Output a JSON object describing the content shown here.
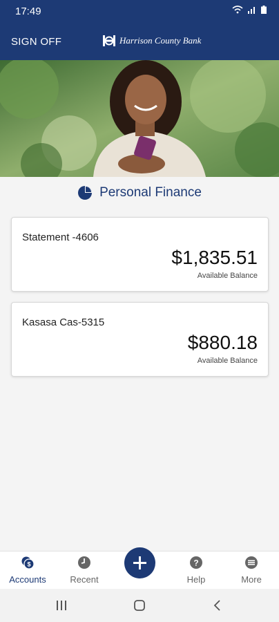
{
  "status_bar": {
    "time": "17:49"
  },
  "header": {
    "sign_off_label": "SIGN OFF",
    "bank_name": "Harrison County Bank"
  },
  "section": {
    "title": "Personal Finance"
  },
  "accounts": [
    {
      "name": "Statement -4606",
      "balance": "$1,835.51",
      "balance_label": "Available Balance"
    },
    {
      "name": "Kasasa Cas-5315",
      "balance": "$880.18",
      "balance_label": "Available Balance"
    }
  ],
  "bottom_nav": {
    "items": [
      {
        "label": "Accounts",
        "icon": "accounts-icon"
      },
      {
        "label": "Recent",
        "icon": "clock-icon"
      },
      {
        "label": "Help",
        "icon": "help-icon"
      },
      {
        "label": "More",
        "icon": "more-icon"
      }
    ],
    "add_icon": "plus-icon",
    "active": "Accounts"
  },
  "colors": {
    "brand": "#1d3a75",
    "background": "#f4f4f4",
    "card": "#ffffff"
  }
}
